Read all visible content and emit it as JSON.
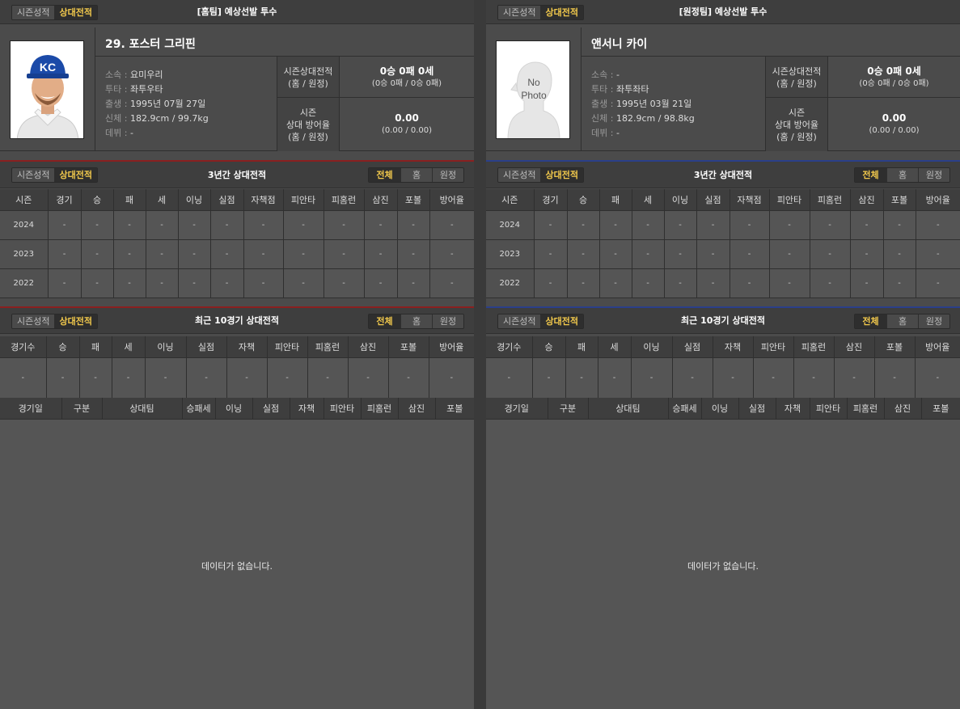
{
  "home": {
    "toggle": {
      "season": "시즌성적",
      "vs": "상대전적"
    },
    "title": "[홈팀] 예상선발 투수",
    "player_name": "29. 포스터 그리핀",
    "info": [
      {
        "k": "소속",
        "v": "요미우리"
      },
      {
        "k": "투타",
        "v": "좌투우타"
      },
      {
        "k": "출생",
        "v": "1995년 07월 27일"
      },
      {
        "k": "신체",
        "v": "182.9cm / 99.7kg"
      },
      {
        "k": "데뷔",
        "v": "-"
      }
    ],
    "stat1_label_1": "시즌상대전적",
    "stat1_label_2": "(홈 / 원정)",
    "stat1_big": "0승 0패 0세",
    "stat1_small": "(0승 0패 / 0승 0패)",
    "stat2_label_1": "시즌",
    "stat2_label_2": "상대 방어율",
    "stat2_label_3": "(홈 / 원정)",
    "stat2_big": "0.00",
    "stat2_small": "(0.00 / 0.00)",
    "photo_label": ""
  },
  "away": {
    "toggle": {
      "season": "시즌성적",
      "vs": "상대전적"
    },
    "title": "[원정팀] 예상선발 투수",
    "player_name": "앤서니 카이",
    "info": [
      {
        "k": "소속",
        "v": "-"
      },
      {
        "k": "투타",
        "v": "좌투좌타"
      },
      {
        "k": "출생",
        "v": "1995년 03월 21일"
      },
      {
        "k": "신체",
        "v": "182.9cm / 98.8kg"
      },
      {
        "k": "데뷔",
        "v": "-"
      }
    ],
    "stat1_label_1": "시즌상대전적",
    "stat1_label_2": "(홈 / 원정)",
    "stat1_big": "0승 0패 0세",
    "stat1_small": "(0승 0패 / 0승 0패)",
    "stat2_label_1": "시즌",
    "stat2_label_2": "상대 방어율",
    "stat2_label_3": "(홈 / 원정)",
    "stat2_big": "0.00",
    "stat2_small": "(0.00 / 0.00)",
    "photo_label_1": "No",
    "photo_label_2": "Photo"
  },
  "three_year": {
    "title": "3년간 상대전적",
    "seg": [
      "전체",
      "홈",
      "원정"
    ],
    "headers": [
      "시즌",
      "경기",
      "승",
      "패",
      "세",
      "이닝",
      "실점",
      "자책점",
      "피안타",
      "피홈런",
      "삼진",
      "포볼",
      "방어율"
    ],
    "years": [
      "2024",
      "2023",
      "2022"
    ],
    "dash": "-"
  },
  "recent10": {
    "title": "최근 10경기 상대전적",
    "seg": [
      "전체",
      "홈",
      "원정"
    ],
    "headers": [
      "경기수",
      "승",
      "패",
      "세",
      "이닝",
      "실점",
      "자책",
      "피안타",
      "피홈런",
      "삼진",
      "포볼",
      "방어율"
    ],
    "dash": "-",
    "log_headers": [
      "경기일",
      "구분",
      "상대팀",
      "승패세",
      "이닝",
      "실점",
      "자책",
      "피안타",
      "피홈런",
      "삼진",
      "포볼"
    ],
    "empty": "데이터가 없습니다."
  }
}
